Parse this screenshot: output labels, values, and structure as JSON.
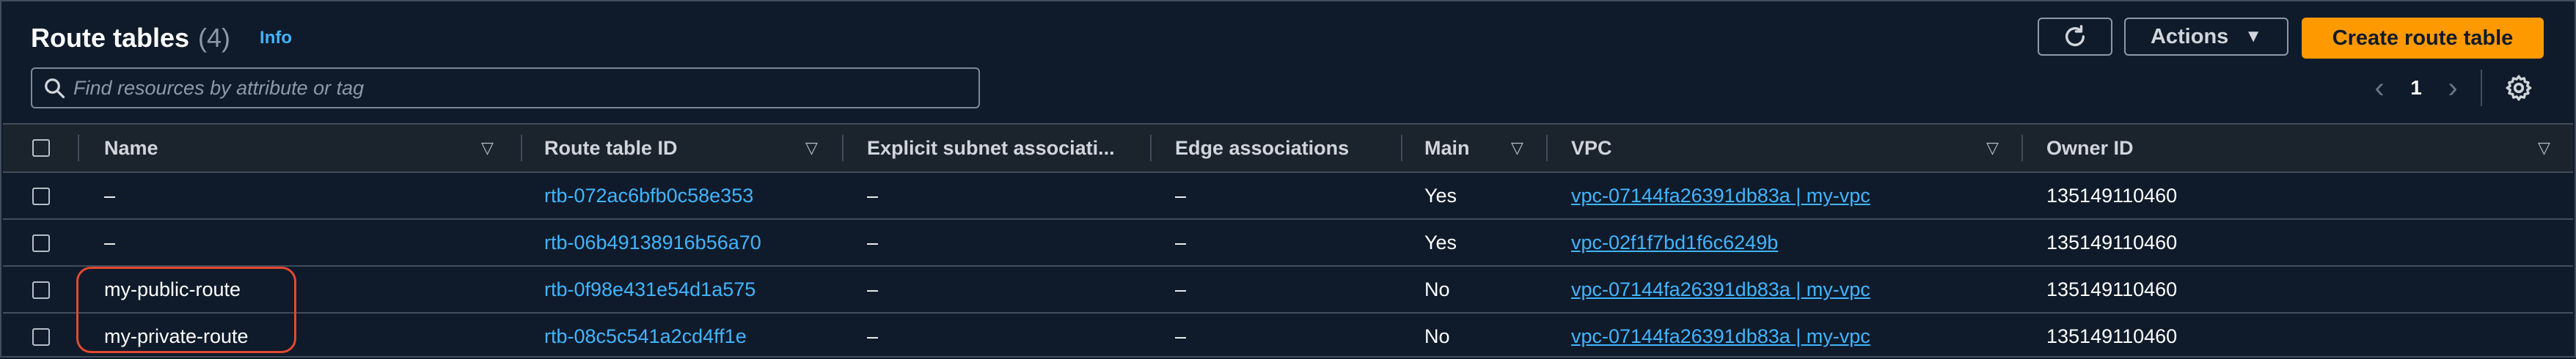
{
  "header": {
    "title": "Route tables",
    "count": "(4)",
    "info_link": "Info",
    "actions_label": "Actions",
    "create_label": "Create route table"
  },
  "search": {
    "placeholder": "Find resources by attribute or tag"
  },
  "pagination": {
    "current_page": "1"
  },
  "columns": {
    "name": "Name",
    "route_table_id": "Route table ID",
    "explicit_subnet": "Explicit subnet associati...",
    "edge_associations": "Edge associations",
    "main": "Main",
    "vpc": "VPC",
    "owner_id": "Owner ID"
  },
  "rows": [
    {
      "name": "–",
      "route_table_id": "rtb-072ac6bfb0c58e353",
      "explicit_subnet": "–",
      "edge": "–",
      "main": "Yes",
      "vpc": "vpc-07144fa26391db83a | my-vpc",
      "owner": "135149110460"
    },
    {
      "name": "–",
      "route_table_id": "rtb-06b49138916b56a70",
      "explicit_subnet": "–",
      "edge": "–",
      "main": "Yes",
      "vpc": "vpc-02f1f7bd1f6c6249b",
      "owner": "135149110460"
    },
    {
      "name": "my-public-route",
      "route_table_id": "rtb-0f98e431e54d1a575",
      "explicit_subnet": "–",
      "edge": "–",
      "main": "No",
      "vpc": "vpc-07144fa26391db83a | my-vpc",
      "owner": "135149110460"
    },
    {
      "name": "my-private-route",
      "route_table_id": "rtb-08c5c541a2cd4ff1e",
      "explicit_subnet": "–",
      "edge": "–",
      "main": "No",
      "vpc": "vpc-07144fa26391db83a | my-vpc",
      "owner": "135149110460"
    }
  ],
  "colors": {
    "accent": "#ff9900",
    "link": "#42b4ff",
    "highlight": "#e2492f",
    "background": "#0f1b2a"
  },
  "icons": [
    "refresh-icon",
    "caret-down-icon",
    "search-icon",
    "chevron-left-icon",
    "chevron-right-icon",
    "gear-icon",
    "sort-icon"
  ]
}
